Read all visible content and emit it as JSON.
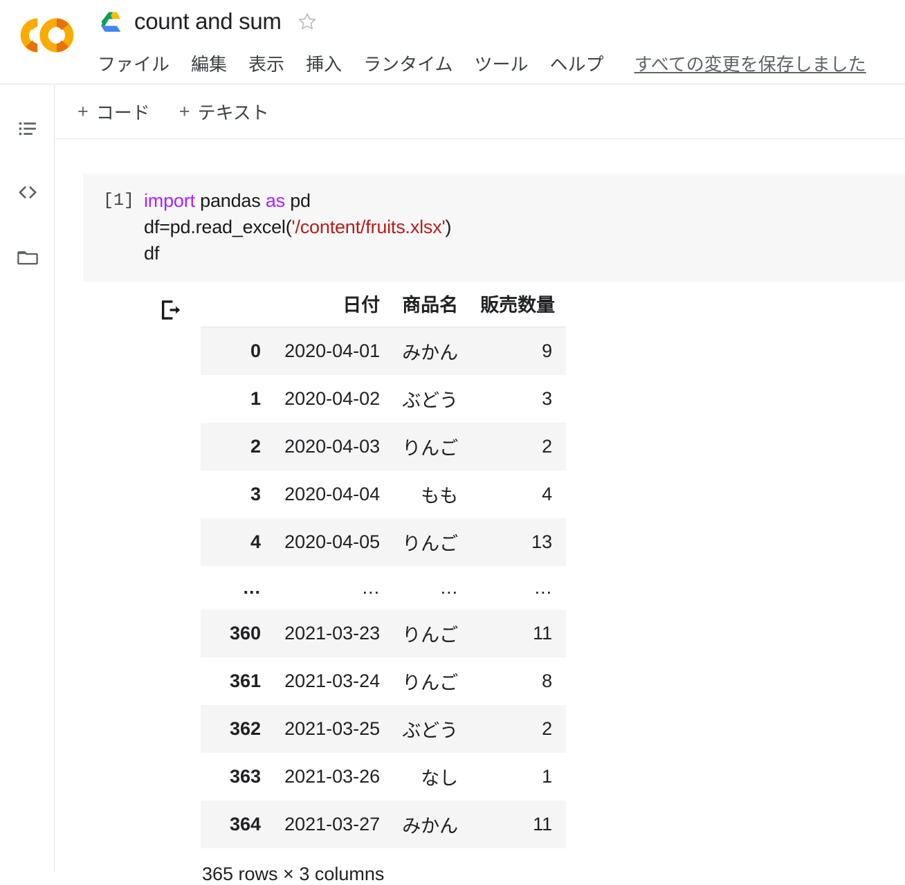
{
  "header": {
    "logo_name": "colab-logo",
    "drive_icon": "google-drive-icon",
    "doc_title": "count and sum",
    "star_icon": "star-outline-icon",
    "menu_items": [
      "ファイル",
      "編集",
      "表示",
      "挿入",
      "ランタイム",
      "ツール",
      "ヘルプ"
    ],
    "save_status": "すべての変更を保存しました"
  },
  "sidebar": {
    "items": [
      {
        "name": "table-of-contents",
        "icon": "list-icon"
      },
      {
        "name": "code-snippets",
        "icon": "code-brackets-icon"
      },
      {
        "name": "files",
        "icon": "folder-icon"
      }
    ]
  },
  "toolbar": {
    "add_code_label": "コード",
    "add_text_label": "テキスト",
    "plus": "+"
  },
  "cell": {
    "prompt": "[1]",
    "code": {
      "line1_kw": "import",
      "line1_rest": " pandas ",
      "line1_kw2": "as",
      "line1_rest2": " pd",
      "line2_pre": "df=pd.read_excel(",
      "line2_str": "'/content/fruits.xlsx'",
      "line2_post": ")",
      "line3": "df"
    }
  },
  "output": {
    "icon": "output-export-icon",
    "columns": [
      "日付",
      "商品名",
      "販売数量"
    ],
    "index_header": "",
    "rows": [
      {
        "index": "0",
        "date": "2020-04-01",
        "name": "みかん",
        "qty": "9"
      },
      {
        "index": "1",
        "date": "2020-04-02",
        "name": "ぶどう",
        "qty": "3"
      },
      {
        "index": "2",
        "date": "2020-04-03",
        "name": "りんご",
        "qty": "2"
      },
      {
        "index": "3",
        "date": "2020-04-04",
        "name": "もも",
        "qty": "4"
      },
      {
        "index": "4",
        "date": "2020-04-05",
        "name": "りんご",
        "qty": "13"
      },
      {
        "index": "...",
        "date": "...",
        "name": "...",
        "qty": "..."
      },
      {
        "index": "360",
        "date": "2021-03-23",
        "name": "りんご",
        "qty": "11"
      },
      {
        "index": "361",
        "date": "2021-03-24",
        "name": "りんご",
        "qty": "8"
      },
      {
        "index": "362",
        "date": "2021-03-25",
        "name": "ぶどう",
        "qty": "2"
      },
      {
        "index": "363",
        "date": "2021-03-26",
        "name": "なし",
        "qty": "1"
      },
      {
        "index": "364",
        "date": "2021-03-27",
        "name": "みかん",
        "qty": "11"
      }
    ],
    "footer": "365 rows × 3 columns"
  },
  "colors": {
    "colab_orange_light": "#f9ab00",
    "colab_orange_dark": "#e8710a",
    "keyword_purple": "#aa22ff",
    "string_red": "#b71c1c",
    "cell_bg": "#f7f7f7",
    "stripe_bg": "#f5f5f5"
  }
}
